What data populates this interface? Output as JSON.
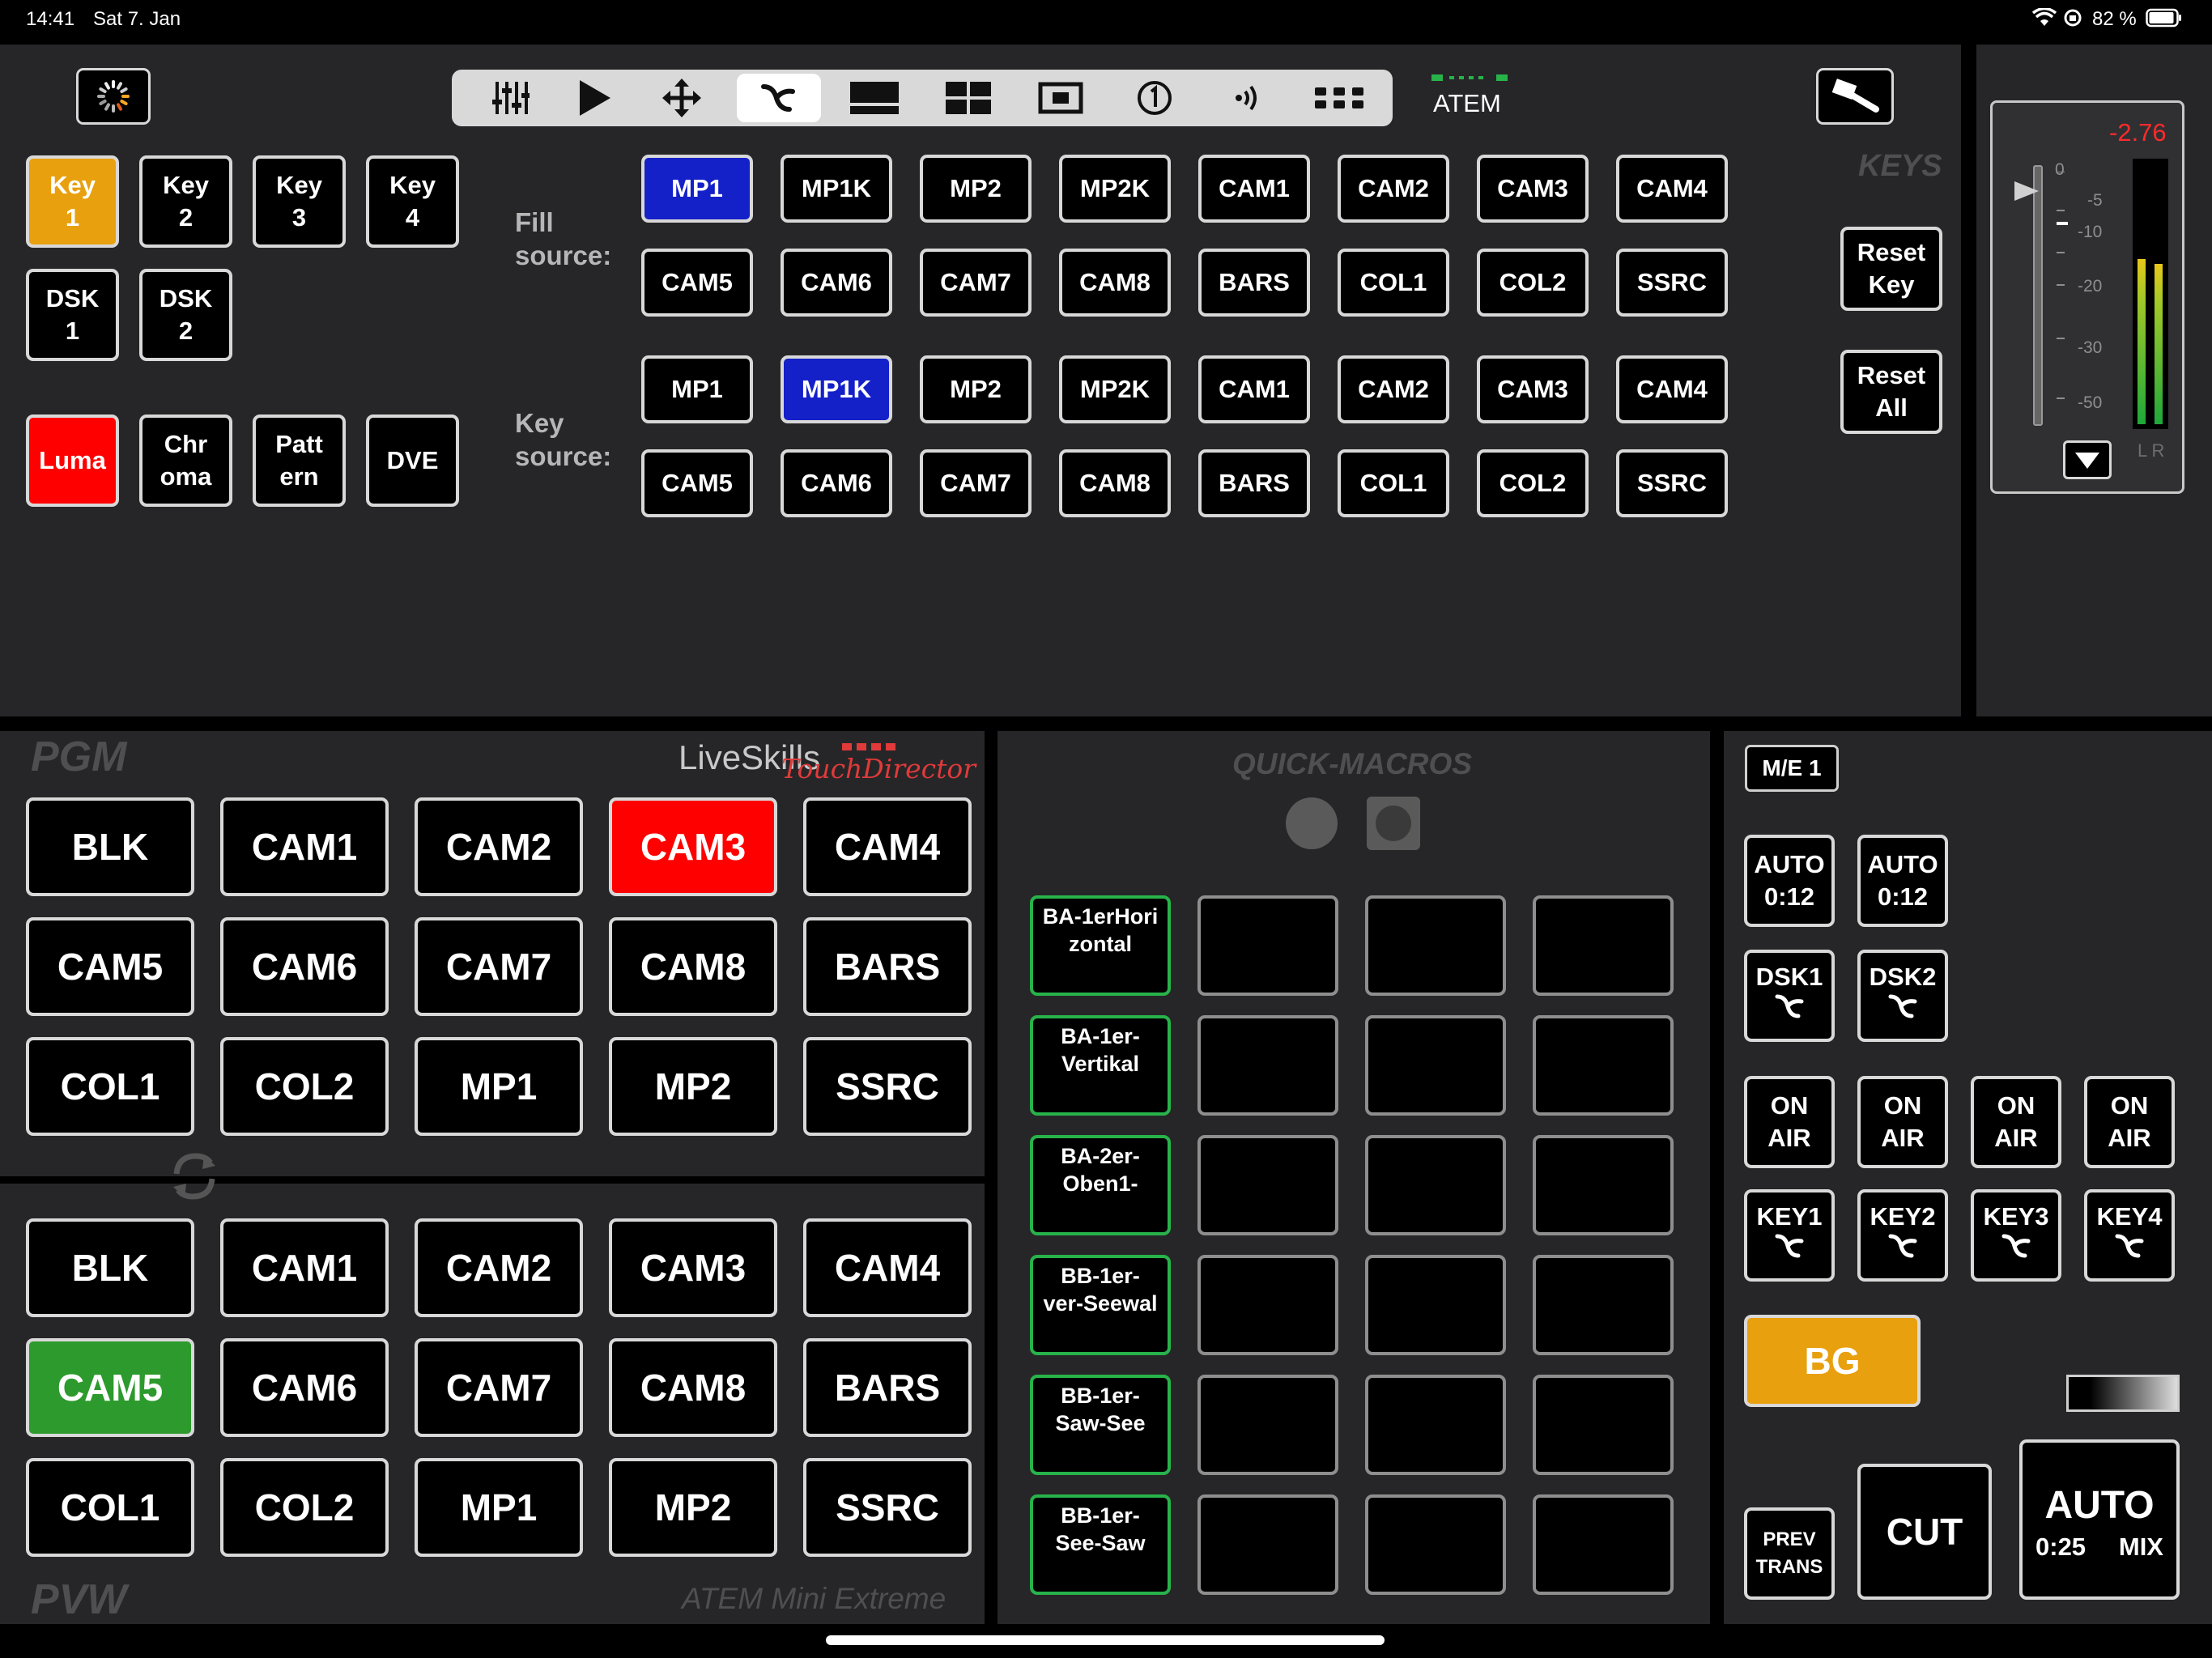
{
  "status_bar": {
    "time": "14:41",
    "date": "Sat 7. Jan",
    "battery": "82 %",
    "icons": [
      "wifi-icon",
      "orientation-lock-icon",
      "battery-icon"
    ]
  },
  "toolbar": {
    "items": [
      "mixer-sliders-icon",
      "play-icon",
      "move-arrows-icon",
      "keyer-icon",
      "downstream-key-icon",
      "multiview-icon",
      "picture-in-picture-icon",
      "macro-number-icon",
      "audio-broadcast-icon",
      "more-grid-icon"
    ],
    "active": "keyer-icon",
    "device_label": "ATEM"
  },
  "keys_panel": {
    "title": "KEYS",
    "key_selectors": [
      {
        "line1": "Key",
        "line2": "1"
      },
      {
        "line1": "Key",
        "line2": "2"
      },
      {
        "line1": "Key",
        "line2": "3"
      },
      {
        "line1": "Key",
        "line2": "4"
      },
      {
        "line1": "DSK",
        "line2": "1"
      },
      {
        "line1": "DSK",
        "line2": "2"
      }
    ],
    "key_types": [
      {
        "line1": "Luma",
        "line2": ""
      },
      {
        "line1": "Chr",
        "line2": "oma"
      },
      {
        "line1": "Patt",
        "line2": "ern"
      },
      {
        "line1": "DVE",
        "line2": ""
      }
    ],
    "fill_label": "Fill\nsource:",
    "key_label": "Key\nsource:",
    "fill_sources": [
      "MP1",
      "MP1K",
      "MP2",
      "MP2K",
      "CAM1",
      "CAM2",
      "CAM3",
      "CAM4",
      "CAM5",
      "CAM6",
      "CAM7",
      "CAM8",
      "BARS",
      "COL1",
      "COL2",
      "SSRC"
    ],
    "key_sources": [
      "MP1",
      "MP1K",
      "MP2",
      "MP2K",
      "CAM1",
      "CAM2",
      "CAM3",
      "CAM4",
      "CAM5",
      "CAM6",
      "CAM7",
      "CAM8",
      "BARS",
      "COL1",
      "COL2",
      "SSRC"
    ],
    "fill_selected": "MP1",
    "key_selected": "MP1K",
    "reset_key": "Reset\nKey",
    "reset_all": "Reset\nAll"
  },
  "audio_meter": {
    "level": "-2.76",
    "scale": [
      "0",
      "-5",
      "-10",
      "-20",
      "-30",
      "-50"
    ],
    "channels": "L R"
  },
  "pgm": {
    "title": "PGM",
    "brand_a": "LiveSkills",
    "brand_b": "TouchDirector",
    "sources": [
      "BLK",
      "CAM1",
      "CAM2",
      "CAM3",
      "CAM4",
      "CAM5",
      "CAM6",
      "CAM7",
      "CAM8",
      "BARS",
      "COL1",
      "COL2",
      "MP1",
      "MP2",
      "SSRC"
    ],
    "selected": "CAM3"
  },
  "pvw": {
    "title": "PVW",
    "model": "ATEM Mini Extreme",
    "sources": [
      "BLK",
      "CAM1",
      "CAM2",
      "CAM3",
      "CAM4",
      "CAM5",
      "CAM6",
      "CAM7",
      "CAM8",
      "BARS",
      "COL1",
      "COL2",
      "MP1",
      "MP2",
      "SSRC"
    ],
    "selected": "CAM5"
  },
  "quick_macros": {
    "title": "QUICK-MACROS",
    "macros": [
      "BA-1erHori\nzontal",
      "",
      "",
      "",
      "BA-1er-\nVertikal",
      "",
      "",
      "",
      "BA-2er-\nOben1-",
      "",
      "",
      "",
      "BB-1er-\nver-Seewal",
      "",
      "",
      "",
      "BB-1er-\nSaw-See",
      "",
      "",
      "",
      "BB-1er-\nSee-Saw",
      "",
      "",
      ""
    ]
  },
  "transition": {
    "me_label": "M/E 1",
    "auto_buttons": [
      {
        "line1": "AUTO",
        "line2": "0:12"
      },
      {
        "line1": "AUTO",
        "line2": "0:12"
      }
    ],
    "dsk_buttons": [
      "DSK1",
      "DSK2"
    ],
    "on_air": [
      "ON\nAIR",
      "ON\nAIR",
      "ON\nAIR",
      "ON\nAIR"
    ],
    "key_buttons": [
      "KEY1",
      "KEY2",
      "KEY3",
      "KEY4"
    ],
    "bg": "BG",
    "prev_trans": "PREV\nTRANS",
    "cut": "CUT",
    "auto": "AUTO",
    "auto_rate": "0:25",
    "auto_type": "MIX"
  },
  "colors": {
    "panel": "#262628",
    "selected_blue": "#1420c8",
    "program_red": "#ff0000",
    "preview_green": "#2c9a2c",
    "amber": "#e8a00e",
    "macro_green": "#27b34a"
  }
}
